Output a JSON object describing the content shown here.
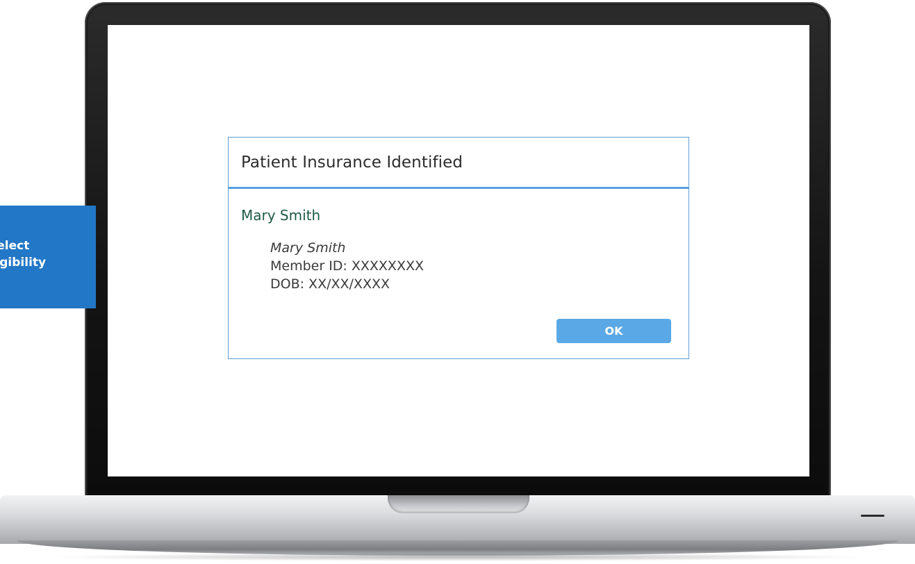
{
  "side_badge": {
    "line1": "Select",
    "line2": "Eligibility",
    "color": "#2277c6"
  },
  "dialog": {
    "title": "Patient Insurance Identified",
    "patient_name": "Mary Smith",
    "details": {
      "name": "Mary Smith",
      "member_id": "Member ID: XXXXXXXX",
      "dob": "DOB: XX/XX/XXXX"
    },
    "ok_label": "OK",
    "accent_color": "#5aa8e6",
    "name_color": "#1e5a46"
  }
}
